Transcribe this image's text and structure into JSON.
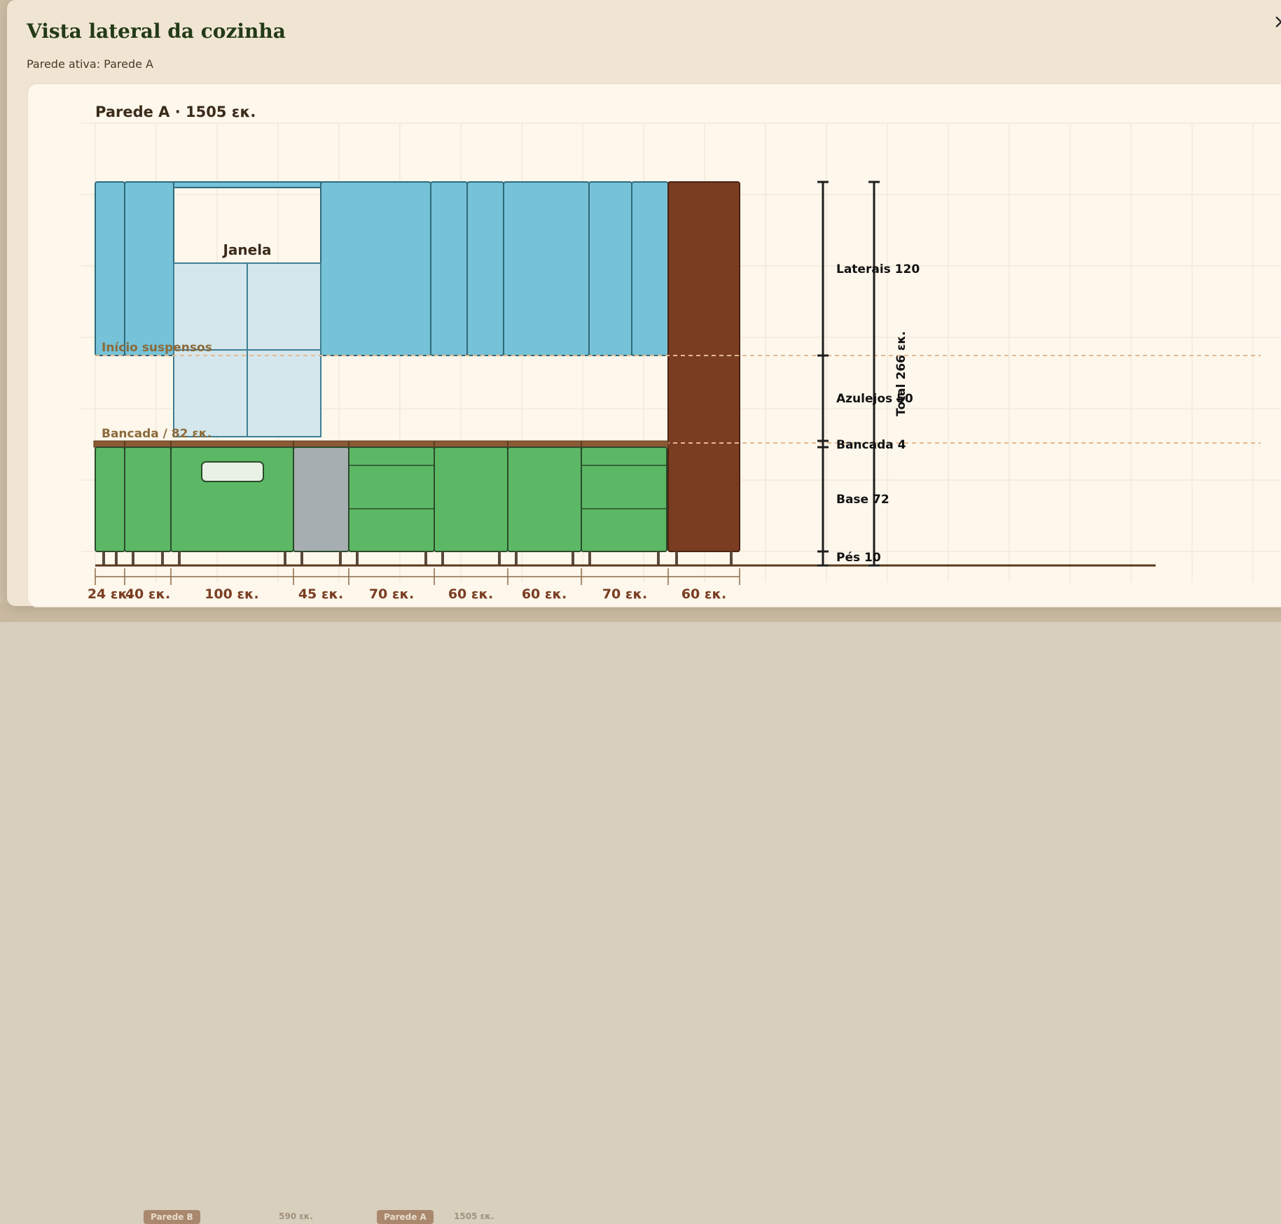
{
  "modal": {
    "title": "Vista lateral da cozinha",
    "subtitle": "Parede ativa: Parede A",
    "close_label": "×"
  },
  "background": {
    "tabs": [
      "Parede B",
      "Parede A"
    ],
    "labels": [
      "590 εκ.",
      "1505 εκ."
    ]
  },
  "drawing": {
    "heading": "Parede A · 1505 εκ.",
    "window_label": "Janela",
    "line_labels": {
      "upper_start": "Início suspensos",
      "counter": "Bancada / 82 εκ."
    },
    "widths": [
      "24 εκ.",
      "40 εκ.",
      "100 εκ.",
      "45 εκ.",
      "70 εκ.",
      "60 εκ.",
      "60 εκ.",
      "70 εκ.",
      "60 εκ."
    ],
    "dimensions": {
      "sides": "Laterais 120",
      "tiles": "Azulejos 50",
      "counter": "Bancada 4",
      "base": "Base 72",
      "feet": "Pés 10",
      "total": "Total 266 εκ."
    },
    "colors": {
      "upper": "#76c2d8",
      "base": "#5cb865",
      "sink_unit": "#a7aeb1",
      "tall_unit": "#7a3d22",
      "countertop": "#8b5a35",
      "window": "#d4e7ec"
    }
  }
}
